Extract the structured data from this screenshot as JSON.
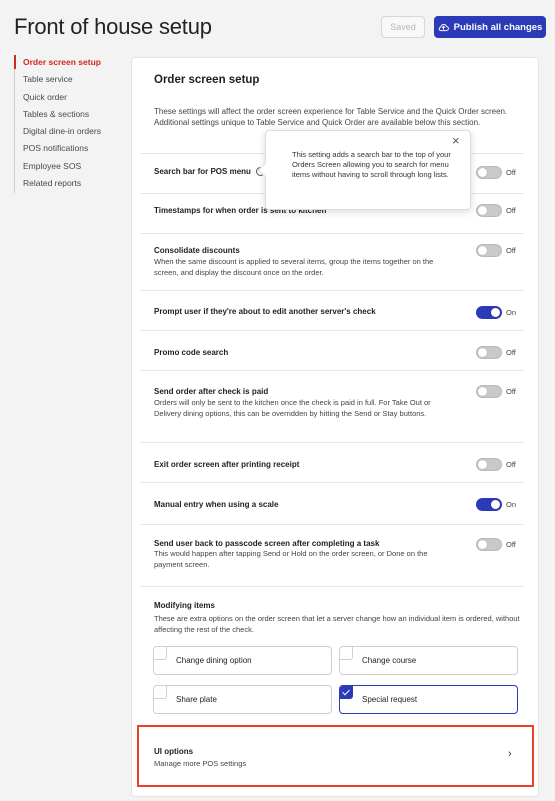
{
  "header": {
    "title": "Front of house setup",
    "saved_label": "Saved",
    "publish_label": "Publish all changes"
  },
  "colors": {
    "accent_blue": "#2b3bb8",
    "active_red": "#cf2a1f",
    "highlight_red": "#e5432a"
  },
  "sidebar": {
    "items": [
      {
        "label": "Order screen setup",
        "active": true
      },
      {
        "label": "Table service"
      },
      {
        "label": "Quick order"
      },
      {
        "label": "Tables & sections"
      },
      {
        "label": "Digital dine-in orders"
      },
      {
        "label": "POS notifications"
      },
      {
        "label": "Employee SOS"
      },
      {
        "label": "Related reports"
      }
    ]
  },
  "main": {
    "title": "Order screen setup",
    "intro": "These settings will affect the order screen experience for Table Service and the Quick Order screen. Additional settings unique to Table Service and Quick Order are available below this section.",
    "settings": [
      {
        "label": "Search bar for POS menu",
        "state": "Off",
        "on": false,
        "icon": "info-icon"
      },
      {
        "label": "Timestamps for when order is sent to kitchen",
        "state": "Off",
        "on": false
      },
      {
        "label": "Consolidate discounts",
        "desc": "When the same discount is applied to several items, group the items together on the screen, and display the discount once on the order.",
        "state": "Off",
        "on": false
      },
      {
        "label": "Prompt user if they're about to edit another server's check",
        "state": "On",
        "on": true
      },
      {
        "label": "Promo code search",
        "state": "Off",
        "on": false
      },
      {
        "label": "Send order after check is paid",
        "desc": "Orders will only be sent to the kitchen once the check is paid in full. For Take Out or Delivery dining options, this can be overridden by hitting the Send or Stay buttons.",
        "state": "Off",
        "on": false
      },
      {
        "label": "Exit order screen after printing receipt",
        "state": "Off",
        "on": false
      },
      {
        "label": "Manual entry when using a scale",
        "state": "On",
        "on": true
      },
      {
        "label": "Send user back to passcode screen after completing a task",
        "desc": "This would happen after tapping Send or Hold on the order screen, or Done on the payment screen.",
        "state": "Off",
        "on": false
      }
    ],
    "tooltip": {
      "text": "This setting adds a search bar to the top of your Orders Screen allowing you to search for menu items without having to scroll through long lists.",
      "close": "×"
    },
    "modifying": {
      "label": "Modifying items",
      "desc": "These are extra options on the order screen that let a server change how an individual item is ordered, without affecting the rest of the check.",
      "options": [
        {
          "label": "Change dining option",
          "checked": false
        },
        {
          "label": "Change course",
          "checked": false
        },
        {
          "label": "Share plate",
          "checked": false
        },
        {
          "label": "Special request",
          "checked": true
        }
      ]
    },
    "ui_options": {
      "title": "UI options",
      "subtitle": "Manage more POS settings",
      "chevron": "›"
    }
  }
}
